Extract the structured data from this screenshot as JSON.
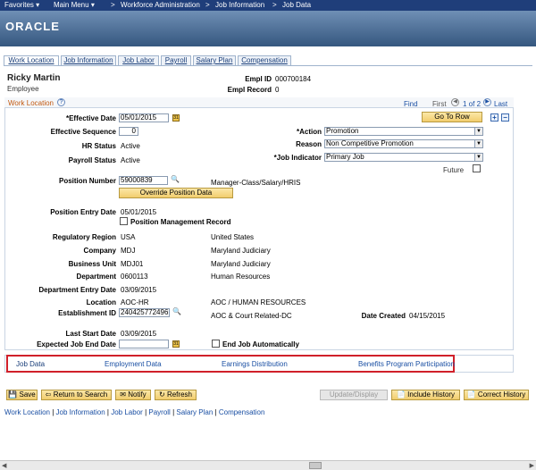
{
  "topnav": {
    "favorites": "Favorites",
    "main_menu": "Main Menu",
    "bc1": "Workforce Administration",
    "bc2": "Job Information",
    "bc3": "Job Data",
    "sep": ">"
  },
  "brand": {
    "logo": "ORACLE"
  },
  "tabs": [
    "Work Location",
    "Job Information",
    "Job Labor",
    "Payroll",
    "Salary Plan",
    "Compensation"
  ],
  "header": {
    "name": "Ricky Martin",
    "role": "Employee",
    "empl_id_label": "Empl ID",
    "empl_id": "000700184",
    "empl_record_label": "Empl Record",
    "empl_record": "0"
  },
  "section": {
    "title": "Work Location",
    "help": "?",
    "find": "Find",
    "first": "First",
    "range": "1 of 2",
    "last": "Last",
    "goto": "Go To Row",
    "plus": "+",
    "minus": "−"
  },
  "fields": {
    "effective_date_label": "*Effective Date",
    "effective_date": "05/01/2015",
    "effective_seq_label": "Effective Sequence",
    "effective_seq": "0",
    "hr_status_label": "HR Status",
    "hr_status": "Active",
    "payroll_status_label": "Payroll Status",
    "payroll_status": "Active",
    "action_label": "*Action",
    "action": "Promotion",
    "reason_label": "Reason",
    "reason": "Non Competitive Promotion",
    "job_indicator_label": "*Job Indicator",
    "job_indicator": "Primary Job",
    "future_label": "Future",
    "position_number_label": "Position Number",
    "position_number": "59000839",
    "position_desc": "Manager-Class/Salary/HRIS",
    "override_btn": "Override Position Data",
    "position_entry_label": "Position Entry Date",
    "position_entry": "05/01/2015",
    "pos_mgmt_label": "Position Management Record",
    "reg_region_label": "Regulatory Region",
    "reg_region": "USA",
    "reg_region_desc": "United States",
    "company_label": "Company",
    "company": "MDJ",
    "company_desc": "Maryland Judiciary",
    "bu_label": "Business Unit",
    "bu": "MDJ01",
    "bu_desc": "Maryland Judiciary",
    "dept_label": "Department",
    "dept": "0600113",
    "dept_desc": "Human Resources",
    "dept_entry_label": "Department Entry Date",
    "dept_entry": "03/09/2015",
    "location_label": "Location",
    "location": "AOC-HR",
    "location_desc": "AOC / HUMAN RESOURCES",
    "estab_label": "Establishment ID",
    "estab": "240425772496",
    "estab_desc": "AOC & Court Related-DC",
    "date_created_label": "Date Created",
    "date_created": "04/15/2015",
    "last_start_label": "Last Start Date",
    "last_start": "03/09/2015",
    "exp_end_label": "Expected Job End Date",
    "exp_end": "",
    "end_auto_label": "End Job Automatically"
  },
  "links": {
    "job_data": "Job Data",
    "employment_data": "Employment Data",
    "earnings": "Earnings Distribution",
    "benefits": "Benefits Program Participation"
  },
  "buttons": {
    "save": "Save",
    "return": "Return to Search",
    "notify": "Notify",
    "refresh": "Refresh",
    "update": "Update/Display",
    "include": "Include History",
    "correct": "Correct History"
  },
  "footer_links": [
    "Work Location",
    "Job Information",
    "Job Labor",
    "Payroll",
    "Salary Plan",
    "Compensation"
  ],
  "footer_sep": "|",
  "colors": {
    "nav": "#1f3e7a",
    "link": "#1a4fa3",
    "highlight": "#d0202a"
  }
}
